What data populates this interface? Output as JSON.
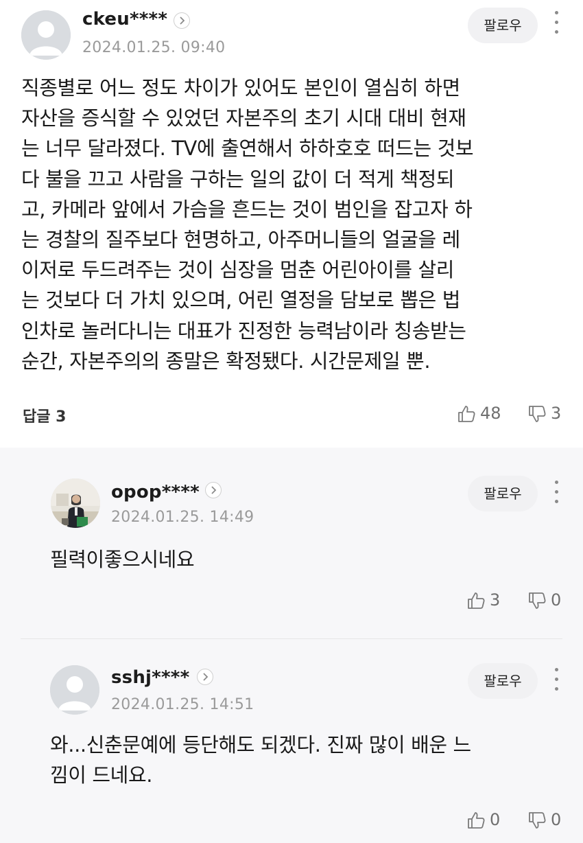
{
  "main_comment": {
    "username": "ckeu****",
    "timestamp": "2024.01.25. 09:40",
    "follow_label": "팔로우",
    "body": "직종별로 어느 정도 차이가 있어도 본인이 열심히 하면\n자산을 증식할 수 있었던 자본주의 초기 시대 대비 현재\n는 너무 달라졌다. TV에 출연해서 하하호호 떠드는 것보\n다 불을 끄고 사람을 구하는 일의 값이 더 적게 책정되\n고, 카메라 앞에서 가슴을 흔드는 것이 범인을 잡고자 하\n는 경찰의 질주보다 현명하고, 아주머니들의 얼굴을 레\n이저로 두드려주는 것이 심장을 멈춘 어린아이를 살리\n는 것보다 더 가치 있으며, 어린 열정을 담보로 뽑은 법\n인차로 놀러다니는 대표가 진정한 능력남이라 칭송받는\n순간, 자본주의의 종말은 확정됐다. 시간문제일 뿐.",
    "reply_label": "답글 3",
    "likes": "48",
    "dislikes": "3"
  },
  "replies": [
    {
      "username": "opop****",
      "timestamp": "2024.01.25. 14:49",
      "follow_label": "팔로우",
      "body": "필력이좋으시네요",
      "likes": "3",
      "dislikes": "0"
    },
    {
      "username": "sshj****",
      "timestamp": "2024.01.25. 14:51",
      "follow_label": "팔로우",
      "body": "와...신춘문예에 등단해도 되겠다. 진짜 많이 배운 느\n낌이 드네요.",
      "likes": "0",
      "dislikes": "0"
    }
  ],
  "icons": {
    "avatar_default": "default-avatar-icon",
    "avatar_photo": "profile-photo-avatar",
    "chevron": "chevron-right-icon",
    "more": "more-vertical-icon",
    "like": "thumbs-up-icon",
    "dislike": "thumbs-down-icon"
  },
  "colors": {
    "reply_background": "#f7f7f9",
    "follow_button_bg": "#f1f1f3",
    "timestamp": "#9a9a9a"
  }
}
